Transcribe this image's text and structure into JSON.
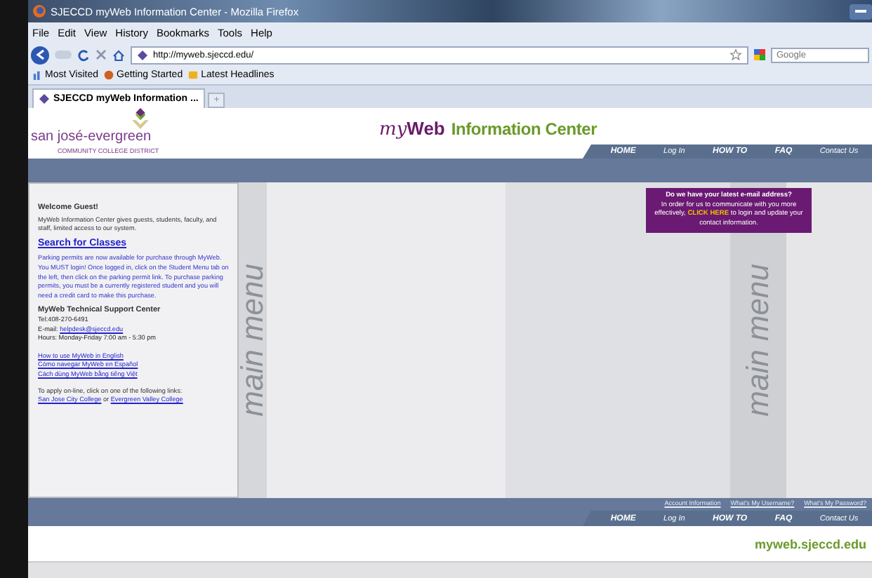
{
  "window": {
    "title": "SJECCD myWeb Information Center - Mozilla Firefox"
  },
  "menu": [
    "File",
    "Edit",
    "View",
    "History",
    "Bookmarks",
    "Tools",
    "Help"
  ],
  "toolbar": {
    "url": "http://myweb.sjeccd.edu/",
    "search_placeholder": "Google"
  },
  "bookmarks": [
    "Most Visited",
    "Getting Started",
    "Latest Headlines"
  ],
  "tabs": [
    {
      "label": "SJECCD myWeb Information ...",
      "selected": true
    }
  ],
  "new_tab": "+",
  "header": {
    "logo_name": "san josé-evergreen",
    "logo_sub": "COMMUNITY COLLEGE DISTRICT",
    "title_my": "my",
    "title_web": "Web",
    "title_rest": "Information Center"
  },
  "nav": [
    "HOME",
    "Log In",
    "HOW TO",
    "FAQ",
    "Contact Us"
  ],
  "decor": [
    "main menu",
    "main menu"
  ],
  "sidebar": {
    "welcome": "Welcome Guest!",
    "intro": "MyWeb Information Center gives guests, students, faculty, and staff, limited access to our system.",
    "search_link": "Search for Classes",
    "parking": "Parking permits are now available for purchase through MyWeb. You MUST login! Once logged in, click on the Student Menu tab on the left, then click on the parking permit link. To purchase parking permits, you must be a currently registered student and you will need a credit card to make this purchase.",
    "support_heading": "MyWeb Technical Support Center",
    "tel": "Tel:408-270-6491",
    "email_label": "E-mail:",
    "email": "helpdesk@sjeccd.edu",
    "hours": "Hours: Monday-Friday 7:00 am - 5:30 pm",
    "language_links": [
      "How to use MyWeb in English",
      "Cómo navegar MyWeb en Español",
      "Cách dùng MyWeb bằng tiếng Việt"
    ],
    "apply_text": "To apply on-line, click on one of the following links:",
    "apply_links": [
      "San Jose City College",
      "Evergreen Valley College"
    ],
    "apply_or": "or"
  },
  "notice": {
    "heading": "Do we have your latest e-mail address?",
    "before": "In order for us to communicate with you more effectively,",
    "link": "CLICK HERE",
    "after": "to login and update your contact information."
  },
  "footer": {
    "links": [
      "Account Information",
      "What's My Username?",
      "What's My Password?"
    ],
    "nav": [
      "HOME",
      "Log In",
      "HOW TO",
      "FAQ",
      "Contact Us"
    ],
    "domain": "myweb.sjeccd.edu"
  }
}
